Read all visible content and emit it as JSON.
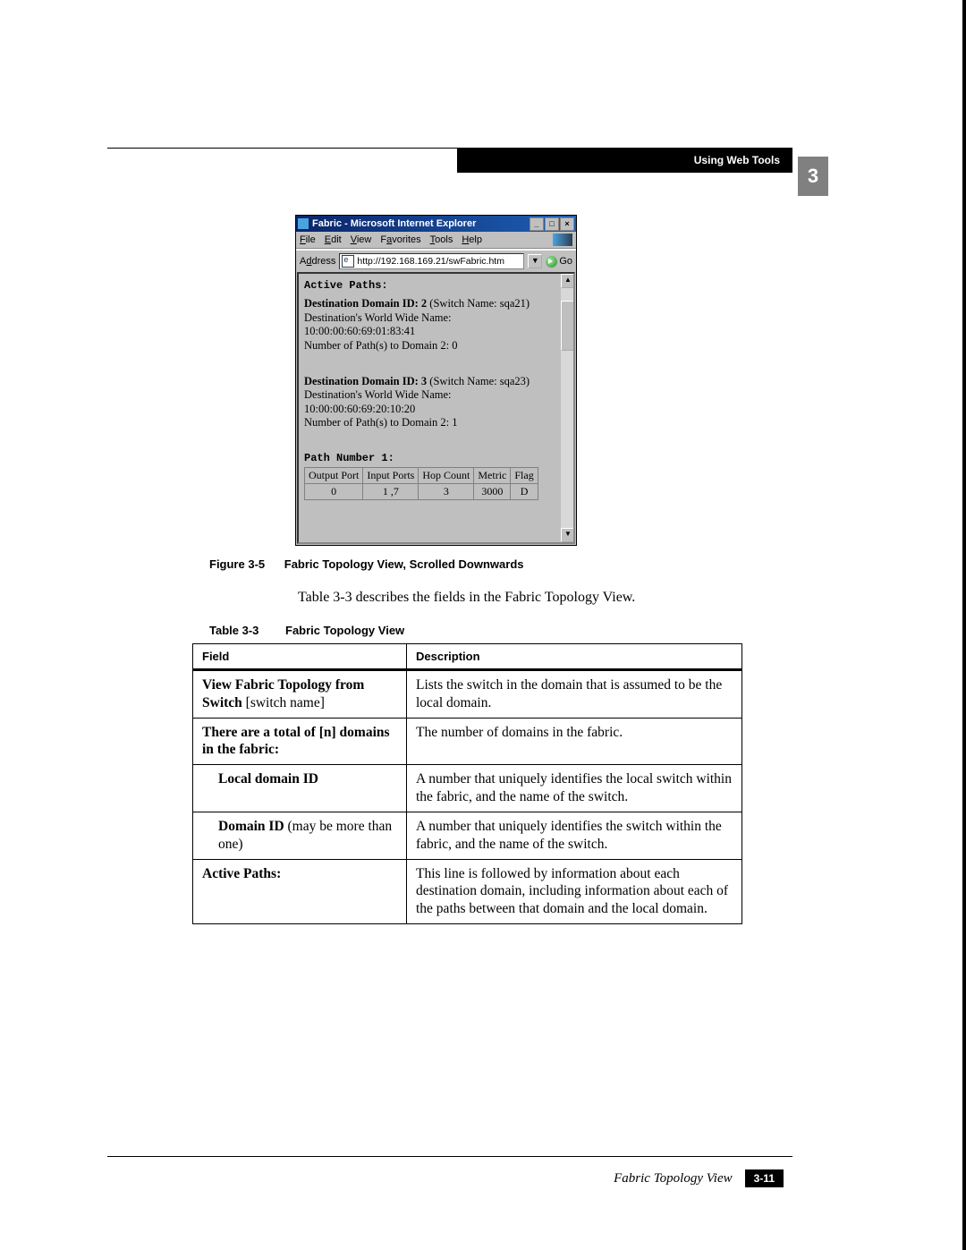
{
  "header": {
    "section_title": "Using Web Tools",
    "chapter_number": "3"
  },
  "ie_window": {
    "title": "Fabric - Microsoft Internet Explorer",
    "menu": {
      "file": "File",
      "edit": "Edit",
      "view": "View",
      "favorites": "Favorites",
      "tools": "Tools",
      "help": "Help"
    },
    "address_label": "Address",
    "url": "http://192.168.169.21/swFabric.htm",
    "go_label": "Go",
    "content": {
      "active_paths_label": "Active Paths:",
      "block1": {
        "dest_line_bold": "Destination Domain ID: 2",
        "dest_line_tail": "  (Switch Name: sqa21)",
        "wwn_label": "Destination's World Wide Name:",
        "wwn_value": "10:00:00:60:69:01:83:41",
        "paths_line": "Number of Path(s) to Domain 2:  0"
      },
      "block2": {
        "dest_line_bold": "Destination Domain ID: 3",
        "dest_line_tail": "  (Switch Name: sqa23)",
        "wwn_label": "Destination's World Wide Name:",
        "wwn_value": "10:00:00:60:69:20:10:20",
        "paths_line": "Number of Path(s) to Domain 2:  1"
      },
      "path_number_label": "Path Number 1:",
      "path_table": {
        "headers": {
          "output": "Output Port",
          "input": "Input Ports",
          "hop": "Hop Count",
          "metric": "Metric",
          "flag": "Flag"
        },
        "row": {
          "output": "0",
          "input": "1 ,7",
          "hop": "3",
          "metric": "3000",
          "flag": "D"
        }
      }
    }
  },
  "figure_caption": {
    "num": "Figure 3-5",
    "text": "Fabric Topology View, Scrolled Downwards"
  },
  "body_para": "Table 3-3 describes the fields in the Fabric Topology View.",
  "table_caption": {
    "num": "Table 3-3",
    "text": "Fabric Topology View"
  },
  "chart_data": {
    "type": "table",
    "title": "Fabric Topology View",
    "columns": [
      "Field",
      "Description"
    ],
    "rows": [
      {
        "field_bold": "View Fabric Topology from Switch",
        "field_tail": " [switch name]",
        "indent": false,
        "description": "Lists the switch in the domain that is assumed to be the local domain."
      },
      {
        "field_bold": "There are a total of [n] domains in the fabric:",
        "field_tail": "",
        "indent": false,
        "description": "The number of domains in the fabric."
      },
      {
        "field_bold": "Local domain ID",
        "field_tail": "",
        "indent": true,
        "description": "A number that uniquely identifies the local switch within the fabric, and the name of the switch."
      },
      {
        "field_bold": "Domain ID",
        "field_tail": " (may be more than one)",
        "indent": true,
        "description": "A number that uniquely identifies the switch within the fabric, and the name of the switch."
      },
      {
        "field_bold": "Active Paths:",
        "field_tail": "",
        "indent": false,
        "description": "This line is followed by information about each destination domain, including information about each of the paths between that domain and the local domain."
      }
    ]
  },
  "footer": {
    "title": "Fabric Topology View",
    "page": "3-11"
  }
}
